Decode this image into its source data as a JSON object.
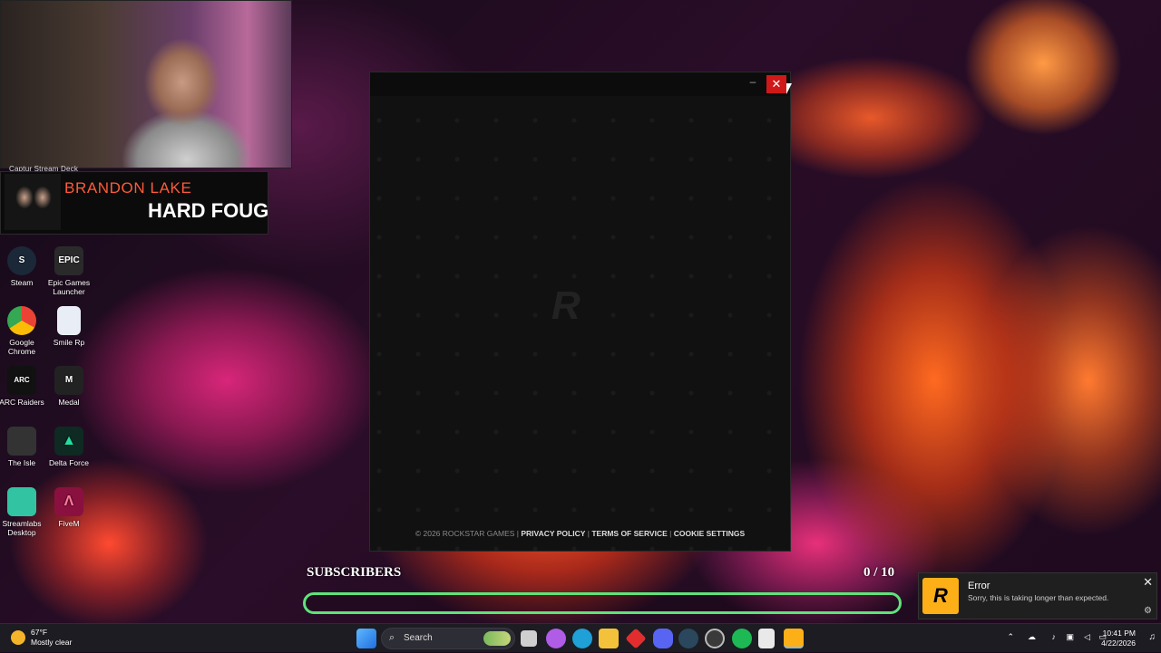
{
  "webcam": {
    "caption": "Captur    Stream Deck"
  },
  "now_playing": {
    "artist": "BRANDON LAKE",
    "song": "HARD FOUGHT"
  },
  "desktop_icons": [
    {
      "label": "Steam",
      "icon": "steam-icon",
      "color": "#1b2838"
    },
    {
      "label": "Epic Games Launcher",
      "icon": "epic-games-icon",
      "color": "#2a2a2a"
    },
    {
      "label": "Google Chrome",
      "icon": "chrome-icon",
      "color": "#4285f4"
    },
    {
      "label": "Smile Rp",
      "icon": "document-icon",
      "color": "#e9eef6"
    },
    {
      "label": "ARC Raiders",
      "icon": "arc-raiders-icon",
      "color": "#111111"
    },
    {
      "label": "Medal",
      "icon": "medal-icon",
      "color": "#222222"
    },
    {
      "label": "The Isle",
      "icon": "the-isle-icon",
      "color": "#333333"
    },
    {
      "label": "Delta Force",
      "icon": "delta-force-icon",
      "color": "#1aa37a"
    },
    {
      "label": "Streamlabs Desktop",
      "icon": "streamlabs-icon",
      "color": "#31c3a2"
    },
    {
      "label": "FiveM",
      "icon": "fivem-icon",
      "color": "#f25a2b"
    }
  ],
  "launcher": {
    "minimize": "–",
    "close": "✕",
    "logo": "R",
    "copyright": "© 2026 ROCKSTAR GAMES",
    "links": [
      "PRIVACY POLICY",
      "TERMS OF SERVICE",
      "COOKIE SETTINGS"
    ]
  },
  "subscribers": {
    "label": "SUBSCRIBERS",
    "count": "0 / 10",
    "progress": 0.0
  },
  "toast": {
    "title": "Error",
    "message": "Sorry, this is taking longer than expected.",
    "close": "✕",
    "settings": "⚙",
    "app_icon": "rockstar-icon"
  },
  "taskbar": {
    "weather": {
      "temp": "67°F",
      "condition": "Mostly clear"
    },
    "search_label": "Search",
    "apps": [
      {
        "icon": "windows-start-icon",
        "color": "#3a9cf5"
      },
      {
        "icon": "task-view-icon",
        "color": "#cfcfcf"
      },
      {
        "icon": "copilot-icon",
        "color": "#b05ce6"
      },
      {
        "icon": "edge-icon",
        "color": "#1fa0d6"
      },
      {
        "icon": "file-explorer-icon",
        "color": "#f3c23a"
      },
      {
        "icon": "app-red-icon",
        "color": "#e12d2d"
      },
      {
        "icon": "discord-icon",
        "color": "#5865f2"
      },
      {
        "icon": "steam-taskbar-icon",
        "color": "#2a475e"
      },
      {
        "icon": "obs-icon",
        "color": "#3a3a3a"
      },
      {
        "icon": "spotify-icon",
        "color": "#1db954"
      },
      {
        "icon": "notepad-icon",
        "color": "#e9e9e9"
      },
      {
        "icon": "rockstar-taskbar-icon",
        "color": "#fcaf17"
      }
    ],
    "time": "10:41 PM",
    "date": "4/22/2026"
  }
}
